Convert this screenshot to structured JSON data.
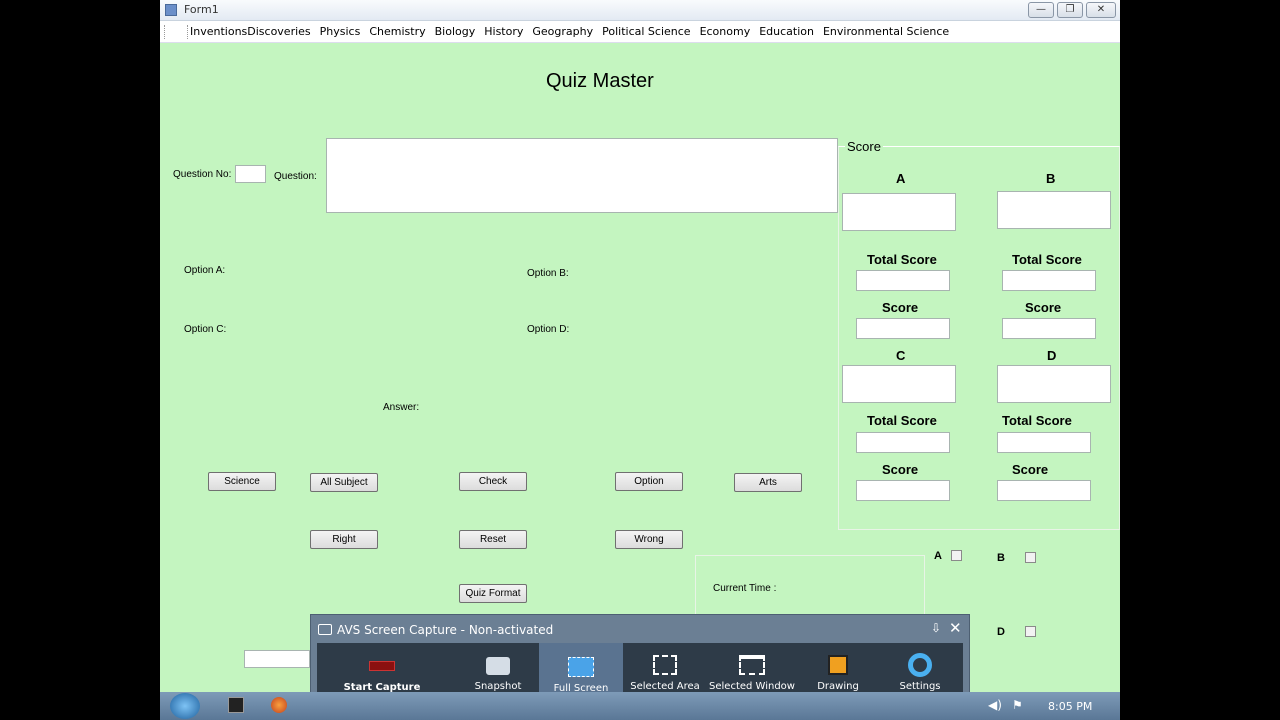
{
  "window": {
    "title": "Form1",
    "minimize": "—",
    "maximize": "❐",
    "close": "✕"
  },
  "menu": [
    "InventionsDiscoveries",
    "Physics",
    "Chemistry",
    "Biology",
    "History",
    "Geography",
    "Political Science",
    "Economy",
    "Education",
    "Environmental Science"
  ],
  "app_title": "Quiz Master",
  "question": {
    "no_label": "Question No:",
    "question_label": "Question:"
  },
  "options": {
    "a": "Option A:",
    "b": "Option B:",
    "c": "Option C:",
    "d": "Option D:",
    "answer": "Answer:"
  },
  "buttons": {
    "science": "Science",
    "all_subject": "All Subject",
    "check": "Check",
    "option": "Option",
    "arts": "Arts",
    "right": "Right",
    "reset": "Reset",
    "wrong": "Wrong",
    "quiz_format": "Quiz Format"
  },
  "score_panel": {
    "title": "Score",
    "a": "A",
    "b": "B",
    "c": "C",
    "d": "D",
    "total_score": "Total Score",
    "score": "Score"
  },
  "checks": {
    "a": "A",
    "b": "B",
    "d": "D"
  },
  "current_time_label": "Current Time :",
  "avs": {
    "title": "AVS Screen Capture - Non-activated",
    "tools": [
      "Start Capture",
      "Snapshot",
      "Full Screen",
      "Selected Area",
      "Selected Window",
      "Drawing",
      "Settings"
    ]
  },
  "taskbar": {
    "time": "8:05 PM"
  }
}
